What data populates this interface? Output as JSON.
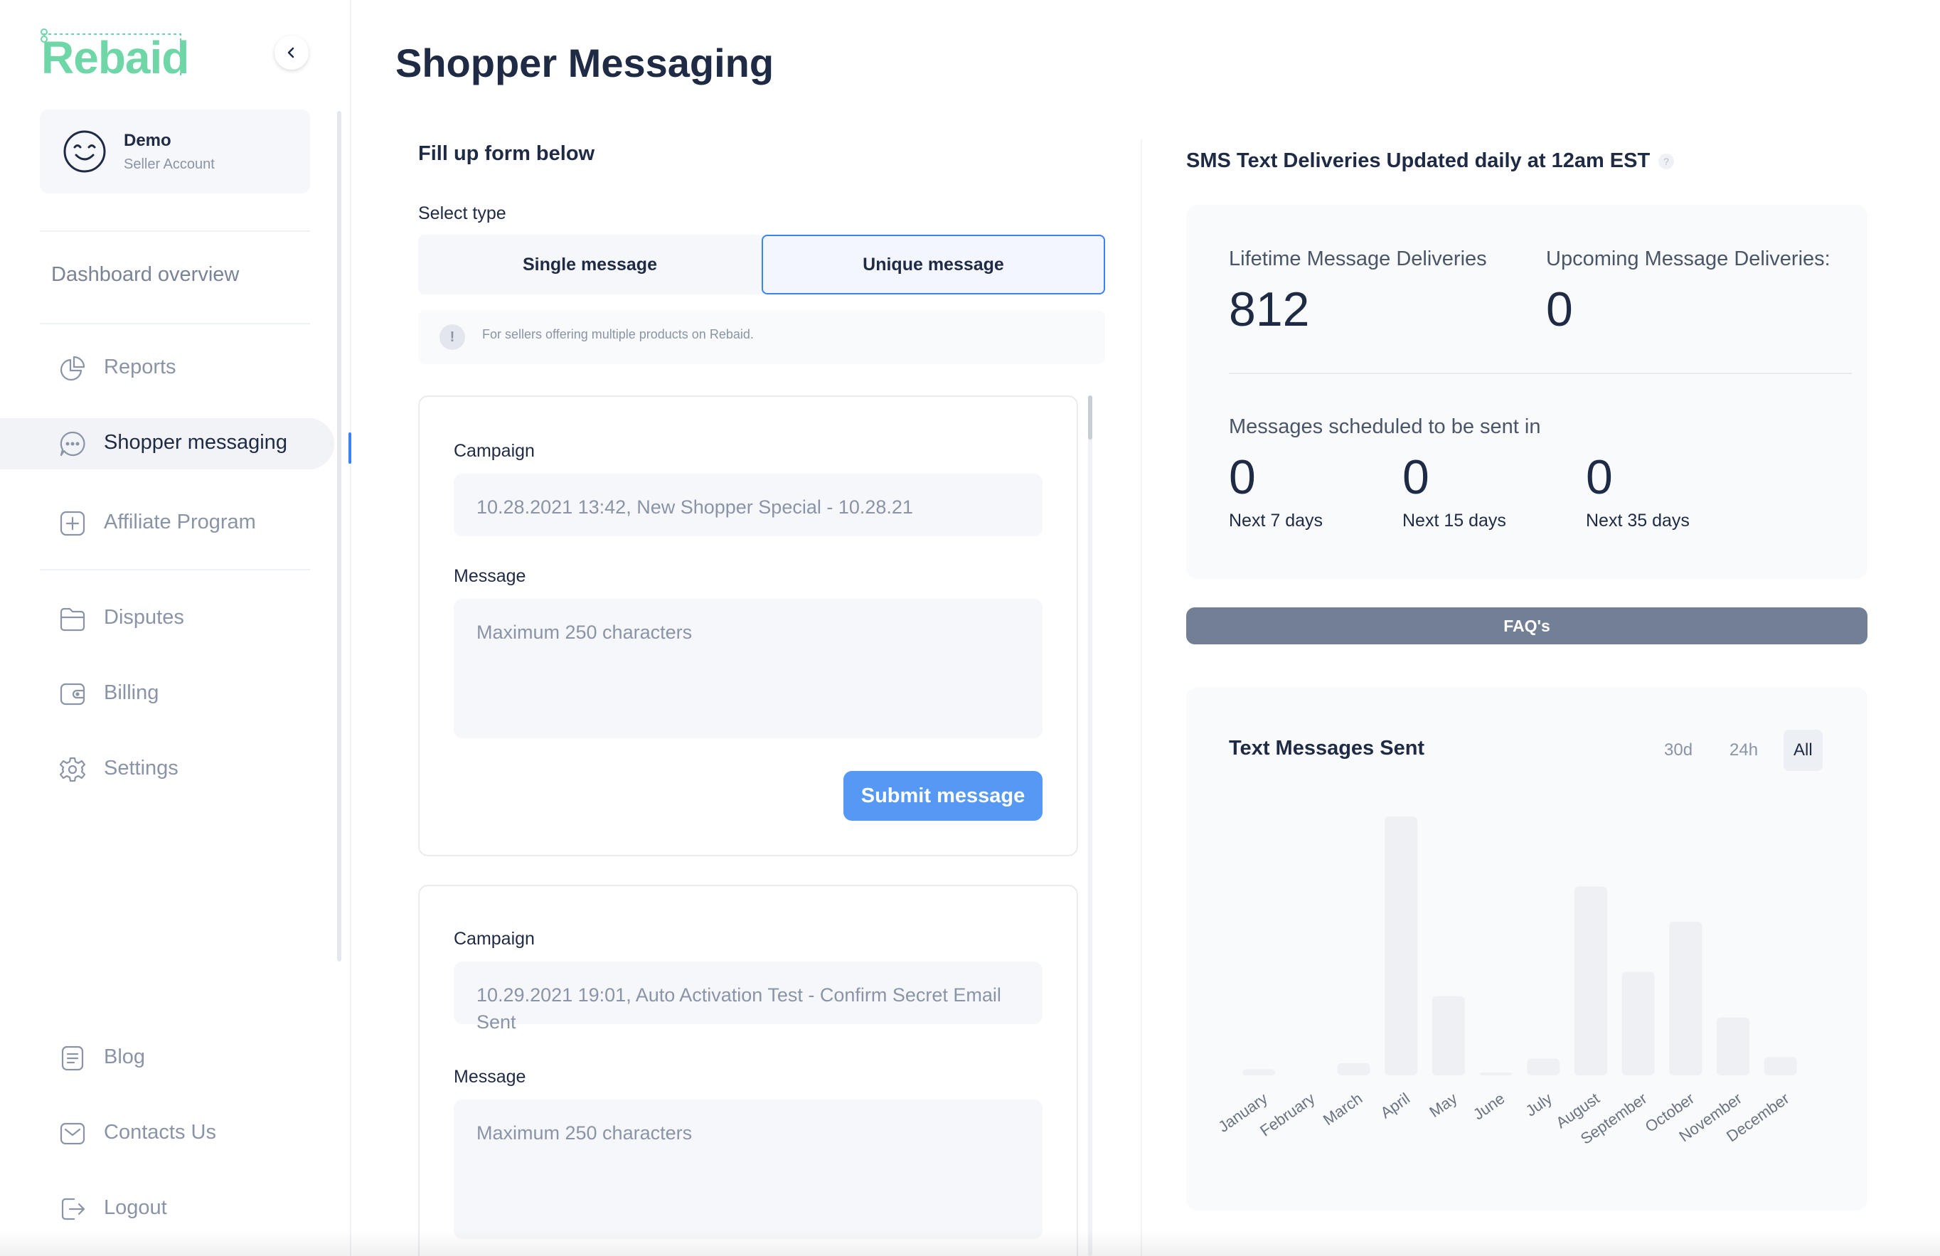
{
  "brand": {
    "name": "Rebaid",
    "color": "#6fd6a8"
  },
  "account": {
    "name": "Demo",
    "type": "Seller Account"
  },
  "sidebar": {
    "dashboard_label": "Dashboard overview",
    "items": [
      {
        "label": "Reports",
        "icon": "pie-chart-icon"
      },
      {
        "label": "Shopper messaging",
        "icon": "chat-icon",
        "active": true
      },
      {
        "label": "Affiliate Program",
        "icon": "plus-square-icon"
      },
      {
        "label": "Disputes",
        "icon": "folder-icon"
      },
      {
        "label": "Billing",
        "icon": "wallet-icon"
      },
      {
        "label": "Settings",
        "icon": "gear-icon"
      }
    ],
    "bottom_items": [
      {
        "label": "Blog",
        "icon": "document-icon"
      },
      {
        "label": "Contacts Us",
        "icon": "mail-icon"
      },
      {
        "label": "Logout",
        "icon": "logout-icon"
      }
    ]
  },
  "page": {
    "title": "Shopper Messaging"
  },
  "form": {
    "heading": "Fill up form below",
    "select_type_label": "Select type",
    "types": [
      "Single message",
      "Unique message"
    ],
    "selected_type": "Unique message",
    "info_icon": "!",
    "info_text": "For sellers offering multiple products on Rebaid.",
    "campaign_label": "Campaign",
    "message_label": "Message",
    "message_placeholder": "Maximum 250 characters",
    "submit_label": "Submit message",
    "cards": [
      {
        "campaign": "10.28.2021 13:42, New Shopper Special - 10.28.21"
      },
      {
        "campaign": "10.29.2021 19:01, Auto Activation Test - Confirm Secret Email Sent"
      }
    ]
  },
  "stats": {
    "heading": "SMS Text Deliveries Updated daily at 12am EST",
    "help_icon": "?",
    "lifetime_label": "Lifetime Message Deliveries",
    "lifetime_value": "812",
    "upcoming_label": "Upcoming Message Deliveries:",
    "upcoming_value": "0",
    "scheduled_label": "Messages scheduled to be sent in",
    "scheduled": [
      {
        "value": "0",
        "label": "Next 7 days"
      },
      {
        "value": "0",
        "label": "Next 15 days"
      },
      {
        "value": "0",
        "label": "Next 35 days"
      }
    ]
  },
  "faq": {
    "label": "FAQ's"
  },
  "chart_data": {
    "type": "bar",
    "title": "Text Messages Sent",
    "range_tabs": [
      "30d",
      "24h",
      "All"
    ],
    "selected_range": "All",
    "categories": [
      "January",
      "February",
      "March",
      "April",
      "May",
      "June",
      "July",
      "August",
      "September",
      "October",
      "November",
      "December"
    ],
    "values": [
      4,
      0,
      8,
      170,
      52,
      2,
      11,
      124,
      68,
      101,
      38,
      12
    ],
    "ylim": [
      0,
      170
    ],
    "grid": false,
    "bar_color": "#eef0f3"
  },
  "colors": {
    "accent": "#3b82f6",
    "primary_button": "#5599f5",
    "faq_button": "#737f95",
    "text_dark": "#1f2a44",
    "text_muted": "#8a94a6"
  }
}
